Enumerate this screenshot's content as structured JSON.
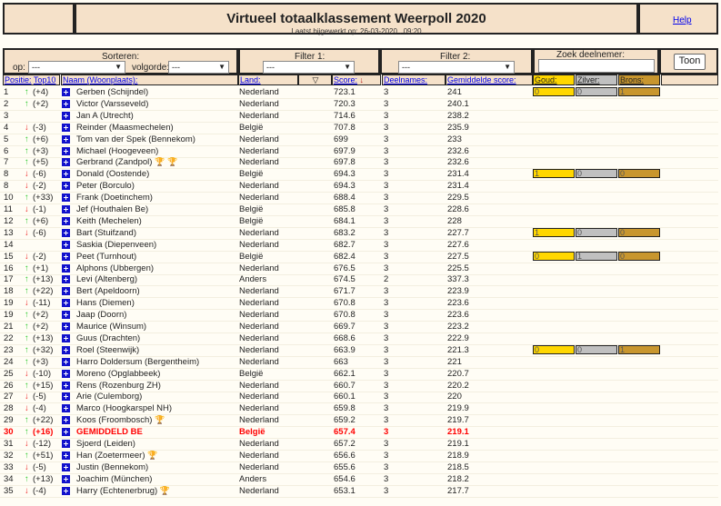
{
  "header": {
    "title": "Virtueel totaalklassement Weerpoll 2020",
    "updated": "Laatst bijgewerkt op: 26-03-2020 , 09:20",
    "help": "Help"
  },
  "controls": {
    "sort_label": "Sorteren:",
    "op_label": "op:",
    "op_value": "---",
    "order_label": "volgorde:",
    "order_value": "---",
    "filter1_label": "Filter 1:",
    "filter1_value": "---",
    "filter2_label": "Filter 2:",
    "filter2_value": "---",
    "search_label": "Zoek deelnemer:",
    "search_value": "",
    "show_button": "Toon"
  },
  "columns": {
    "pos": "Positie:",
    "top10": "Top10",
    "name": "Naam (Woonplaats):",
    "land": "Land:",
    "score": "Score:",
    "deelnames": "Deelnames:",
    "avg": "Gemiddelde score:",
    "gold": "Goud:",
    "silver": "Zilver:",
    "bronze": "Brons:"
  },
  "colors": {
    "gold": "#ffd700",
    "silver": "#c0c0c0",
    "bronze": "#c8962e",
    "highlight": "#ff0000"
  },
  "rows": [
    {
      "pos": "1",
      "dir": "up",
      "chg": "(+4)",
      "name": "Gerben (Schijndel)",
      "land": "Nederland",
      "score": "723.1",
      "n": "3",
      "avg": "241",
      "medals": [
        "0",
        "0",
        "1"
      ]
    },
    {
      "pos": "2",
      "dir": "up",
      "chg": "(+2)",
      "name": "Victor (Varsseveld)",
      "land": "Nederland",
      "score": "720.3",
      "n": "3",
      "avg": "240.1"
    },
    {
      "pos": "3",
      "dir": "",
      "chg": "",
      "name": "Jan A (Utrecht)",
      "land": "Nederland",
      "score": "714.6",
      "n": "3",
      "avg": "238.2"
    },
    {
      "pos": "4",
      "dir": "down",
      "chg": "(-3)",
      "name": "Reinder (Maasmechelen)",
      "land": "België",
      "score": "707.8",
      "n": "3",
      "avg": "235.9"
    },
    {
      "pos": "5",
      "dir": "up",
      "chg": "(+6)",
      "name": "Tom van der Spek (Bennekom)",
      "land": "Nederland",
      "score": "699",
      "n": "3",
      "avg": "233"
    },
    {
      "pos": "6",
      "dir": "up",
      "chg": "(+3)",
      "name": "Michael (Hoogeveen)",
      "land": "Nederland",
      "score": "697.9",
      "n": "3",
      "avg": "232.6"
    },
    {
      "pos": "7",
      "dir": "up",
      "chg": "(+5)",
      "name": "Gerbrand (Zandpol)",
      "land": "Nederland",
      "score": "697.8",
      "n": "3",
      "avg": "232.6",
      "trophies": [
        "bronze",
        "bronze"
      ]
    },
    {
      "pos": "8",
      "dir": "down",
      "chg": "(-6)",
      "name": "Donald (Oostende)",
      "land": "België",
      "score": "694.3",
      "n": "3",
      "avg": "231.4",
      "medals": [
        "1",
        "0",
        "0"
      ]
    },
    {
      "pos": "8",
      "dir": "down",
      "chg": "(-2)",
      "name": "Peter (Borculo)",
      "land": "Nederland",
      "score": "694.3",
      "n": "3",
      "avg": "231.4"
    },
    {
      "pos": "10",
      "dir": "up",
      "chg": "(+33)",
      "name": "Frank (Doetinchem)",
      "land": "Nederland",
      "score": "688.4",
      "n": "3",
      "avg": "229.5"
    },
    {
      "pos": "11",
      "dir": "down",
      "chg": "(-1)",
      "name": "Jef (Houthalen Be)",
      "land": "België",
      "score": "685.8",
      "n": "3",
      "avg": "228.6"
    },
    {
      "pos": "12",
      "dir": "up",
      "chg": "(+6)",
      "name": "Keith (Mechelen)",
      "land": "België",
      "score": "684.1",
      "n": "3",
      "avg": "228"
    },
    {
      "pos": "13",
      "dir": "down",
      "chg": "(-6)",
      "name": "Bart (Stuifzand)",
      "land": "Nederland",
      "score": "683.2",
      "n": "3",
      "avg": "227.7",
      "medals": [
        "1",
        "0",
        "0"
      ]
    },
    {
      "pos": "14",
      "dir": "",
      "chg": "",
      "name": "Saskia (Diepenveen)",
      "land": "Nederland",
      "score": "682.7",
      "n": "3",
      "avg": "227.6"
    },
    {
      "pos": "15",
      "dir": "down",
      "chg": "(-2)",
      "name": "Peet (Turnhout)",
      "land": "België",
      "score": "682.4",
      "n": "3",
      "avg": "227.5",
      "medals": [
        "0",
        "1",
        "0"
      ]
    },
    {
      "pos": "16",
      "dir": "up",
      "chg": "(+1)",
      "name": "Alphons (Ubbergen)",
      "land": "Nederland",
      "score": "676.5",
      "n": "3",
      "avg": "225.5"
    },
    {
      "pos": "17",
      "dir": "up",
      "chg": "(+13)",
      "name": "Levi (Altenberg)",
      "land": "Anders",
      "score": "674.5",
      "n": "2",
      "avg": "337.3"
    },
    {
      "pos": "18",
      "dir": "up",
      "chg": "(+22)",
      "name": "Bert (Apeldoorn)",
      "land": "Nederland",
      "score": "671.7",
      "n": "3",
      "avg": "223.9"
    },
    {
      "pos": "19",
      "dir": "down",
      "chg": "(-11)",
      "name": "Hans (Diemen)",
      "land": "Nederland",
      "score": "670.8",
      "n": "3",
      "avg": "223.6"
    },
    {
      "pos": "19",
      "dir": "up",
      "chg": "(+2)",
      "name": "Jaap (Doorn)",
      "land": "Nederland",
      "score": "670.8",
      "n": "3",
      "avg": "223.6"
    },
    {
      "pos": "21",
      "dir": "up",
      "chg": "(+2)",
      "name": "Maurice (Winsum)",
      "land": "Nederland",
      "score": "669.7",
      "n": "3",
      "avg": "223.2"
    },
    {
      "pos": "22",
      "dir": "up",
      "chg": "(+13)",
      "name": "Guus (Drachten)",
      "land": "Nederland",
      "score": "668.6",
      "n": "3",
      "avg": "222.9"
    },
    {
      "pos": "23",
      "dir": "up",
      "chg": "(+32)",
      "name": "Roel (Steenwijk)",
      "land": "Nederland",
      "score": "663.9",
      "n": "3",
      "avg": "221.3",
      "medals": [
        "0",
        "0",
        "1"
      ]
    },
    {
      "pos": "24",
      "dir": "up",
      "chg": "(+3)",
      "name": "Harro Doldersum (Bergentheim)",
      "land": "Nederland",
      "score": "663",
      "n": "3",
      "avg": "221"
    },
    {
      "pos": "25",
      "dir": "down",
      "chg": "(-10)",
      "name": "Moreno (Opglabbeek)",
      "land": "België",
      "score": "662.1",
      "n": "3",
      "avg": "220.7"
    },
    {
      "pos": "26",
      "dir": "up",
      "chg": "(+15)",
      "name": "Rens (Rozenburg ZH)",
      "land": "Nederland",
      "score": "660.7",
      "n": "3",
      "avg": "220.2"
    },
    {
      "pos": "27",
      "dir": "down",
      "chg": "(-5)",
      "name": "Arie (Culemborg)",
      "land": "Nederland",
      "score": "660.1",
      "n": "3",
      "avg": "220"
    },
    {
      "pos": "28",
      "dir": "down",
      "chg": "(-4)",
      "name": "Marco (Hoogkarspel NH)",
      "land": "Nederland",
      "score": "659.8",
      "n": "3",
      "avg": "219.9"
    },
    {
      "pos": "29",
      "dir": "up",
      "chg": "(+22)",
      "name": "Koos (Froombosch)",
      "land": "Nederland",
      "score": "659.2",
      "n": "3",
      "avg": "219.7",
      "trophies": [
        "gold"
      ]
    },
    {
      "pos": "30",
      "dir": "up",
      "chg": "(+16)",
      "name": "GEMIDDELD BE",
      "land": "België",
      "score": "657.4",
      "n": "3",
      "avg": "219.1",
      "highlight": true
    },
    {
      "pos": "31",
      "dir": "down",
      "chg": "(-12)",
      "name": "Sjoerd (Leiden)",
      "land": "Nederland",
      "score": "657.2",
      "n": "3",
      "avg": "219.1"
    },
    {
      "pos": "32",
      "dir": "up",
      "chg": "(+51)",
      "name": "Han (Zoetermeer)",
      "land": "Nederland",
      "score": "656.6",
      "n": "3",
      "avg": "218.9",
      "trophies": [
        "bronze"
      ]
    },
    {
      "pos": "33",
      "dir": "down",
      "chg": "(-5)",
      "name": "Justin (Bennekom)",
      "land": "Nederland",
      "score": "655.6",
      "n": "3",
      "avg": "218.5"
    },
    {
      "pos": "34",
      "dir": "up",
      "chg": "(+13)",
      "name": "Joachim (München)",
      "land": "Anders",
      "score": "654.6",
      "n": "3",
      "avg": "218.2"
    },
    {
      "pos": "35",
      "dir": "down",
      "chg": "(-4)",
      "name": "Harry (Echtenerbrug)",
      "land": "Nederland",
      "score": "653.1",
      "n": "3",
      "avg": "217.7",
      "trophies": [
        "gold"
      ]
    }
  ]
}
